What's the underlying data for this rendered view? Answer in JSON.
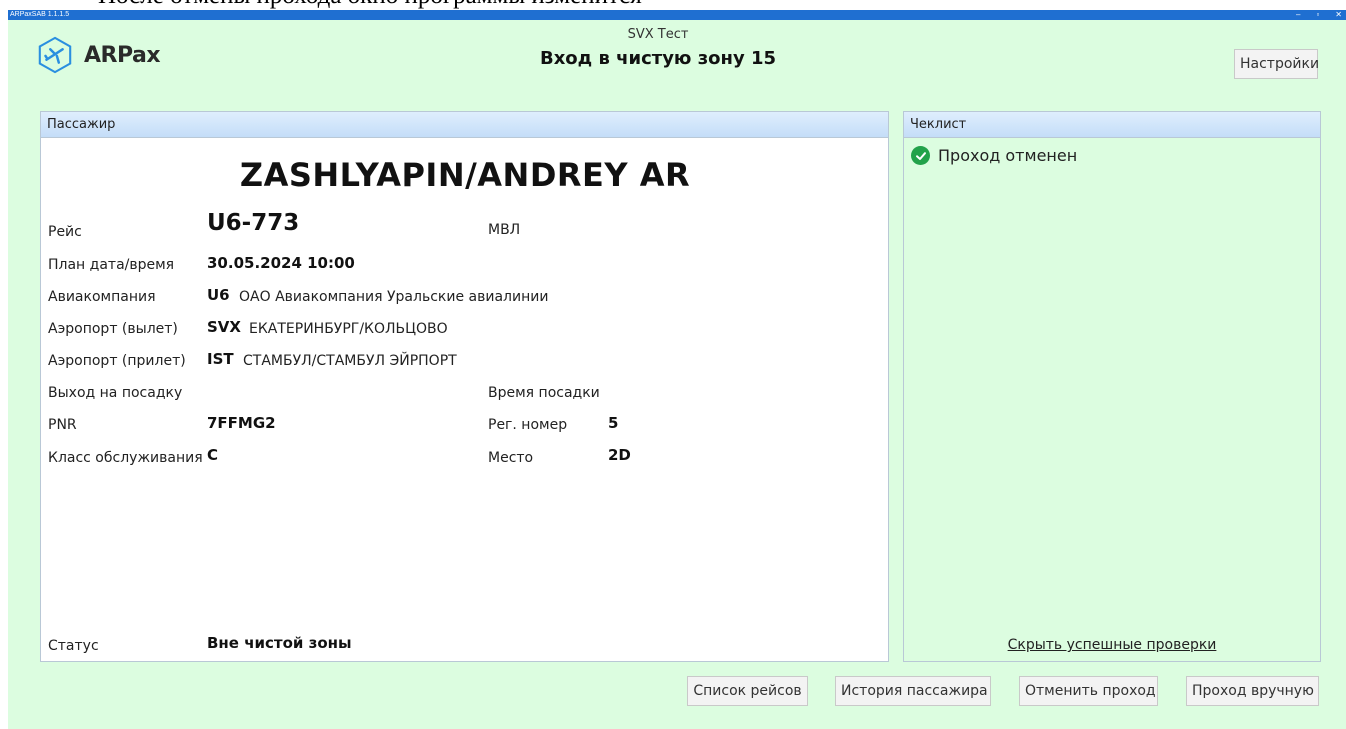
{
  "caption": "После отмены прохода окно программы изменится",
  "window": {
    "title": "ARPaxSAB 1.1.1.5",
    "minimize": "–",
    "maximize": "▫",
    "close": "✕"
  },
  "colors": {
    "app_background": "#dcfde0",
    "titlebar": "#1f6fd1",
    "check_ok": "#22a24a",
    "logo_accent": "#2a8fe0"
  },
  "header": {
    "logo_text": "ARPax",
    "logo_icon": "airplane-hexagon-icon",
    "subtitle": "SVX Тест",
    "title": "Вход в чистую зону 15",
    "settings_label": "Настройки"
  },
  "passenger": {
    "panel_title": "Пассажир",
    "name": "ZASHLYAPIN/ANDREY AR",
    "labels": {
      "flight": "Рейс",
      "planned": "План дата/время",
      "airline": "Авиакомпания",
      "dep_airport": "Аэропорт (вылет)",
      "arr_airport": "Аэропорт (прилет)",
      "gate": "Выход на посадку",
      "boarding_time": "Время посадки",
      "pnr": "PNR",
      "reg_number": "Рег. номер",
      "service_class": "Класс обслуживания",
      "seat": "Место",
      "status": "Статус"
    },
    "values": {
      "flight": "U6-773",
      "flight_type": "МВЛ",
      "planned": "30.05.2024 10:00",
      "airline_code": "U6",
      "airline_name": "ОАО Авиакомпания Уральские авиалинии",
      "dep_code": "SVX",
      "dep_name": "ЕКАТЕРИНБУРГ/КОЛЬЦОВО",
      "arr_code": "IST",
      "arr_name": "СТАМБУЛ/СТАМБУЛ ЭЙРПОРТ",
      "gate": "",
      "boarding_time": "",
      "pnr": "7FFMG2",
      "reg_number": "5",
      "service_class": "C",
      "seat": "2D",
      "status": "Вне чистой зоны"
    }
  },
  "checklist": {
    "panel_title": "Чеклист",
    "items": [
      {
        "label": "Проход отменен",
        "icon": "check-circle-icon"
      }
    ],
    "hide_link": "Скрыть успешные проверки"
  },
  "footer": {
    "flights_list": "Список рейсов",
    "pax_history": "История пассажира",
    "cancel_pass": "Отменить проход",
    "manual_pass": "Проход вручную"
  }
}
